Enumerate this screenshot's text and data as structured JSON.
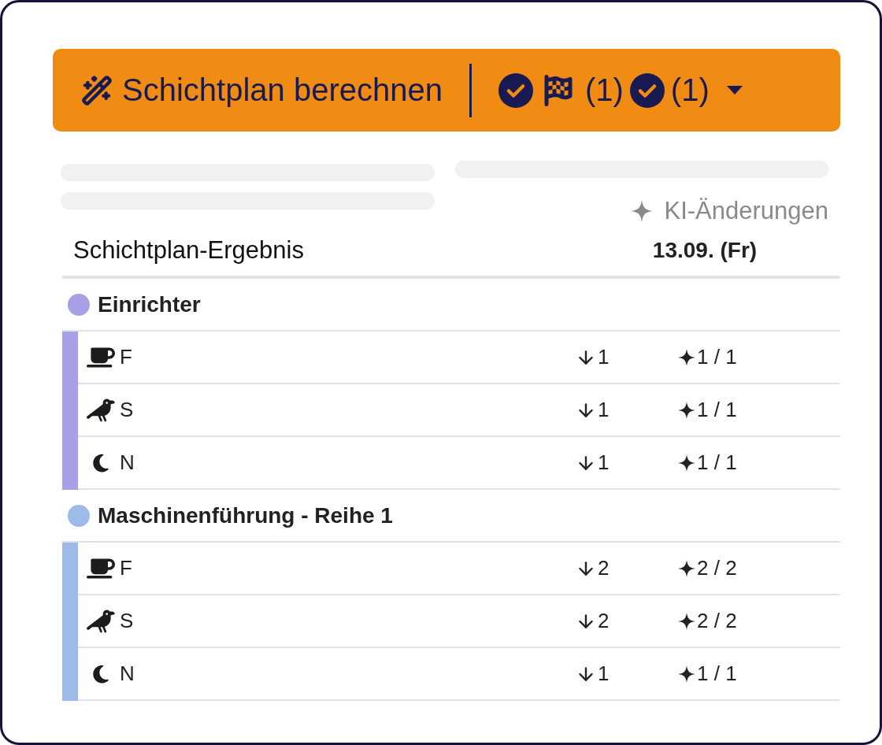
{
  "compute_button": {
    "label": "Schichtplan berechnen"
  },
  "status_dropdown": {
    "items": [
      {
        "kind": "flag",
        "count": "(1)"
      },
      {
        "kind": "plain",
        "count": "(1)"
      }
    ]
  },
  "ai_changes": "KI-Änderungen",
  "table": {
    "title": "Schichtplan-Ergebnis",
    "date": "13.09. (Fr)",
    "groups": [
      {
        "name": "Einrichter",
        "color": "#a8a0e6",
        "rows": [
          {
            "kind": "cup",
            "label": "F",
            "demand": "1",
            "assigned": "1 / 1"
          },
          {
            "kind": "bird",
            "label": "S",
            "demand": "1",
            "assigned": "1 / 1"
          },
          {
            "kind": "moon",
            "label": "N",
            "demand": "1",
            "assigned": "1 / 1"
          }
        ]
      },
      {
        "name": "Maschinenführung - Reihe 1",
        "color": "#9dbbe8",
        "rows": [
          {
            "kind": "cup",
            "label": "F",
            "demand": "2",
            "assigned": "2 / 2"
          },
          {
            "kind": "bird",
            "label": "S",
            "demand": "2",
            "assigned": "2 / 2"
          },
          {
            "kind": "moon",
            "label": "N",
            "demand": "1",
            "assigned": "1 / 1"
          }
        ]
      }
    ]
  }
}
